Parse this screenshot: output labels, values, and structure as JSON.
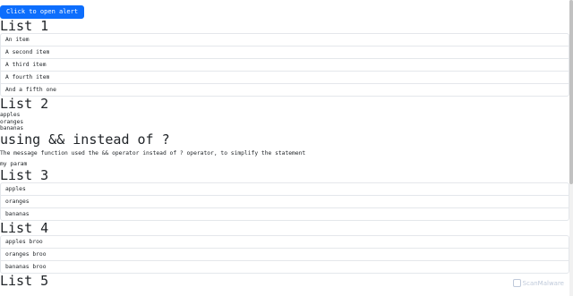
{
  "alert_button": {
    "label": "Click to open alert"
  },
  "list1": {
    "title": "List 1",
    "items": [
      "An item",
      "A second item",
      "A third item",
      "A fourth item",
      "And a fifth one"
    ]
  },
  "list2": {
    "title": "List 2",
    "items": [
      "apples",
      "oranges",
      "bananas"
    ]
  },
  "section": {
    "title": "using && instead of ?",
    "description": "The message function used the && operator instead of ? operator, to simplify the statement",
    "param": "my param"
  },
  "list3": {
    "title": "List 3",
    "items": [
      "apples",
      "oranges",
      "bananas"
    ]
  },
  "list4": {
    "title": "List 4",
    "items": [
      "apples broo",
      "oranges broo",
      "bananas broo"
    ]
  },
  "list5": {
    "title": "List 5"
  },
  "watermark": {
    "text": "ScanMalware"
  }
}
